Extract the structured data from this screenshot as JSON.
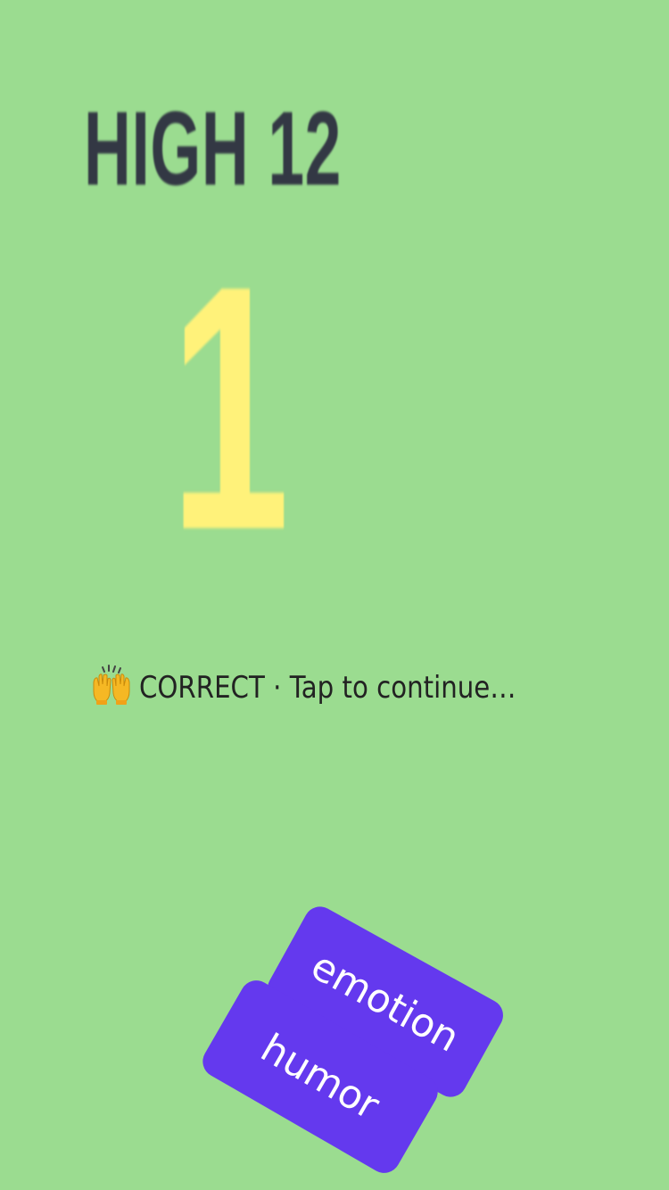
{
  "game": {
    "high_score_text": "HIGH 12",
    "current_score": "1",
    "status_text": "CORRECT · Tap to continue…",
    "status_icon": "raising-hands-emoji"
  },
  "cards": {
    "emotion_label": "emotion",
    "humor_label": "humor"
  },
  "colors": {
    "background": "#9bdc90",
    "high_score": "#333844",
    "current_score": "#fff27a",
    "card": "#6439ee",
    "card_text": "#ffffff",
    "status_text": "#222222"
  }
}
